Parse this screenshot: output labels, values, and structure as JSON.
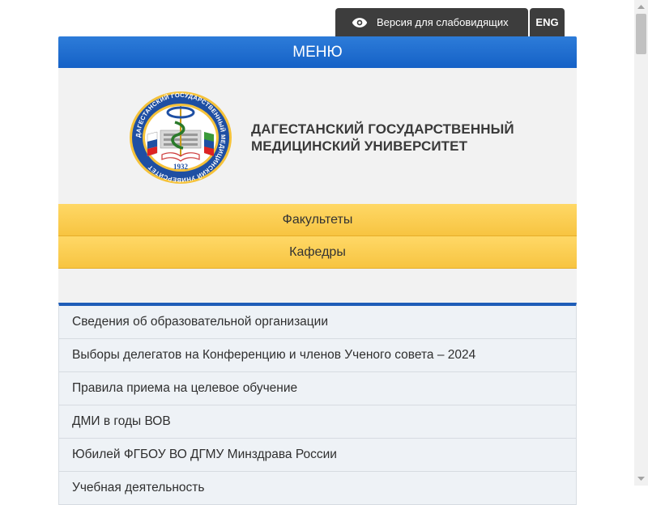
{
  "topbar": {
    "vision_label": "Версия для слабовидящих",
    "eng_label": "ENG"
  },
  "menu": {
    "label": "МЕНЮ"
  },
  "header": {
    "title_line1": "ДАГЕСТАНСКИЙ ГОСУДАРСТВЕННЫЙ",
    "title_line2": "МЕДИЦИНСКИЙ УНИВЕРСИТЕТ",
    "logo_year": "1932",
    "logo_ring_text": "ДАГЕСТАНСКИЙ ГОСУДАРСТВЕННЫЙ МЕДИЦИНСКИЙ УНИВЕРСИТЕТ"
  },
  "yellow_menu": [
    {
      "label": "Факультеты"
    },
    {
      "label": "Кафедры"
    }
  ],
  "links": [
    {
      "label": "Сведения об образовательной организации"
    },
    {
      "label": "Выборы делегатов на Конференцию и членов Ученого совета – 2024"
    },
    {
      "label": "Правила приема на целевое обучение"
    },
    {
      "label": "ДМИ в годы ВОВ"
    },
    {
      "label": "Юбилей ФГБОУ ВО ДГМУ Минздрава России"
    },
    {
      "label": "Учебная деятельность"
    }
  ],
  "colors": {
    "menu_blue": "#1f6fd0",
    "accent_yellow": "#f9cc4f",
    "topbar_dark": "#3d3d3d",
    "list_border_blue": "#1e5db8"
  }
}
